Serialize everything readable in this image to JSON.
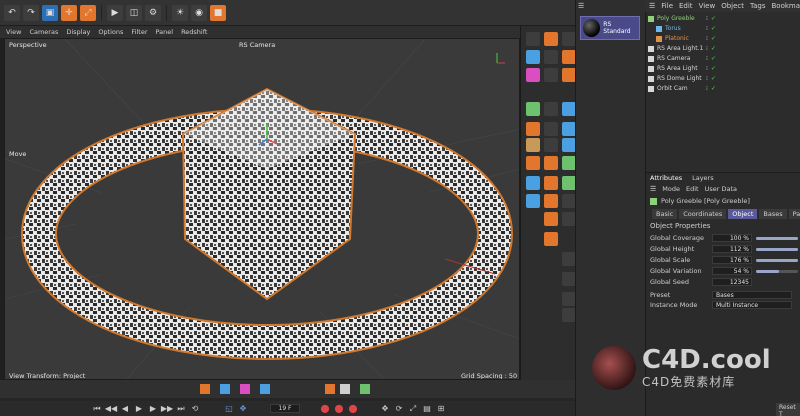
{
  "top_toolbar": {
    "icons": [
      "undo-icon",
      "redo-icon",
      "select-icon",
      "move-icon",
      "scale-icon",
      "rotate-icon",
      "render-icon",
      "picture-viewer-icon",
      "edit-render-settings-icon",
      "light-icon",
      "camera-icon",
      "cube-icon"
    ]
  },
  "viewport": {
    "menu": [
      "View",
      "Cameras",
      "Display",
      "Options",
      "Filter",
      "Panel",
      "Redshift"
    ],
    "mode_label": "Perspective",
    "camera_label": "RS Camera",
    "tool_label": "Move",
    "status_left": "View Transform: Project",
    "status_right": "Grid Spacing : 50 cm"
  },
  "transport": {
    "frame": "19 F"
  },
  "materials": {
    "items": [
      {
        "name": "RS Standard"
      }
    ]
  },
  "object_manager": {
    "menu": [
      "File",
      "Edit",
      "View",
      "Object",
      "Tags",
      "Bookmarks"
    ],
    "rows": [
      {
        "name": "Poly Greeble",
        "color": "#8fd07a",
        "indent": 0
      },
      {
        "name": "Torus",
        "color": "#6fb7e8",
        "indent": 1
      },
      {
        "name": "Platonic",
        "color": "#e0924a",
        "indent": 1
      },
      {
        "name": "RS Area Light.1",
        "color": "#d7d7d7",
        "indent": 0
      },
      {
        "name": "RS Camera",
        "color": "#d7d7d7",
        "indent": 0
      },
      {
        "name": "RS Area Light",
        "color": "#d7d7d7",
        "indent": 0
      },
      {
        "name": "RS Dome Light",
        "color": "#d7d7d7",
        "indent": 0
      },
      {
        "name": "Orbit Cam",
        "color": "#d7d7d7",
        "indent": 0
      }
    ]
  },
  "attributes": {
    "tabs_top": [
      "Attributes",
      "Layers"
    ],
    "menu": [
      "Mode",
      "Edit",
      "User Data"
    ],
    "object_title": "Poly Greeble [Poly Greeble]",
    "tabs": [
      "Basic",
      "Coordinates",
      "Object",
      "Bases",
      "Panels"
    ],
    "active_tab": "Object",
    "section_title": "Object Properties",
    "fields": [
      {
        "label": "Global Coverage",
        "value": "100 %",
        "level": 1.0
      },
      {
        "label": "Global Height",
        "value": "112 %",
        "level": 1.0
      },
      {
        "label": "Global Scale",
        "value": "176 %",
        "level": 1.0
      },
      {
        "label": "Global Variation",
        "value": "54 %",
        "level": 0.54
      },
      {
        "label": "Global Seed",
        "value": "12345",
        "level": null
      }
    ],
    "preset_label": "Preset",
    "preset_value": "Bases",
    "instance_mode_label": "Instance Mode",
    "instance_mode_value": "Multi Instance"
  },
  "bottom_right": {
    "reset_label": "Reset T"
  },
  "watermark": {
    "brand": "C4D.cool",
    "subtitle": "C4D免费素材库"
  },
  "colors": {
    "accent_blue": "#4a4a8a",
    "orange": "#e2762c",
    "green": "#8fd07a"
  }
}
